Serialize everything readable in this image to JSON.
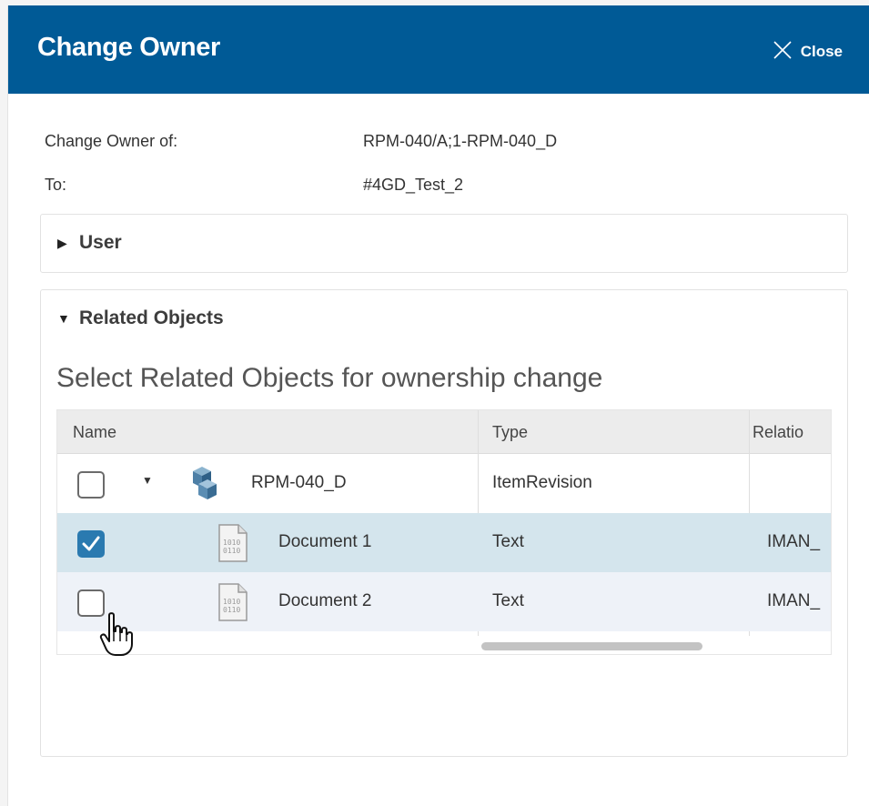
{
  "dialog": {
    "title": "Change Owner",
    "close_label": "Close"
  },
  "info": {
    "change_owner_of_label": "Change Owner of:",
    "change_owner_of_value": "RPM-040/A;1-RPM-040_D",
    "to_label": "To:",
    "to_value": "#4GD_Test_2"
  },
  "user_section": {
    "label": "User",
    "expanded": false
  },
  "related_section": {
    "label": "Related Objects",
    "expanded": true,
    "subtitle": "Select Related Objects for ownership change",
    "columns": [
      "Name",
      "Type",
      "Relatio"
    ],
    "rows": [
      {
        "name": "RPM-040_D",
        "type": "ItemRevision",
        "relation": "",
        "checked": false,
        "icon": "item-revision-icon"
      },
      {
        "name": "Document 1",
        "type": "Text",
        "relation": "IMAN_",
        "checked": true,
        "icon": "text-document-icon"
      },
      {
        "name": "Document 2",
        "type": "Text",
        "relation": "IMAN_",
        "checked": false,
        "icon": "text-document-icon"
      }
    ]
  },
  "colors": {
    "header_bg": "#005a96",
    "selected_row": "#d4e5ed",
    "checkbox_checked": "#2a7ab0"
  }
}
